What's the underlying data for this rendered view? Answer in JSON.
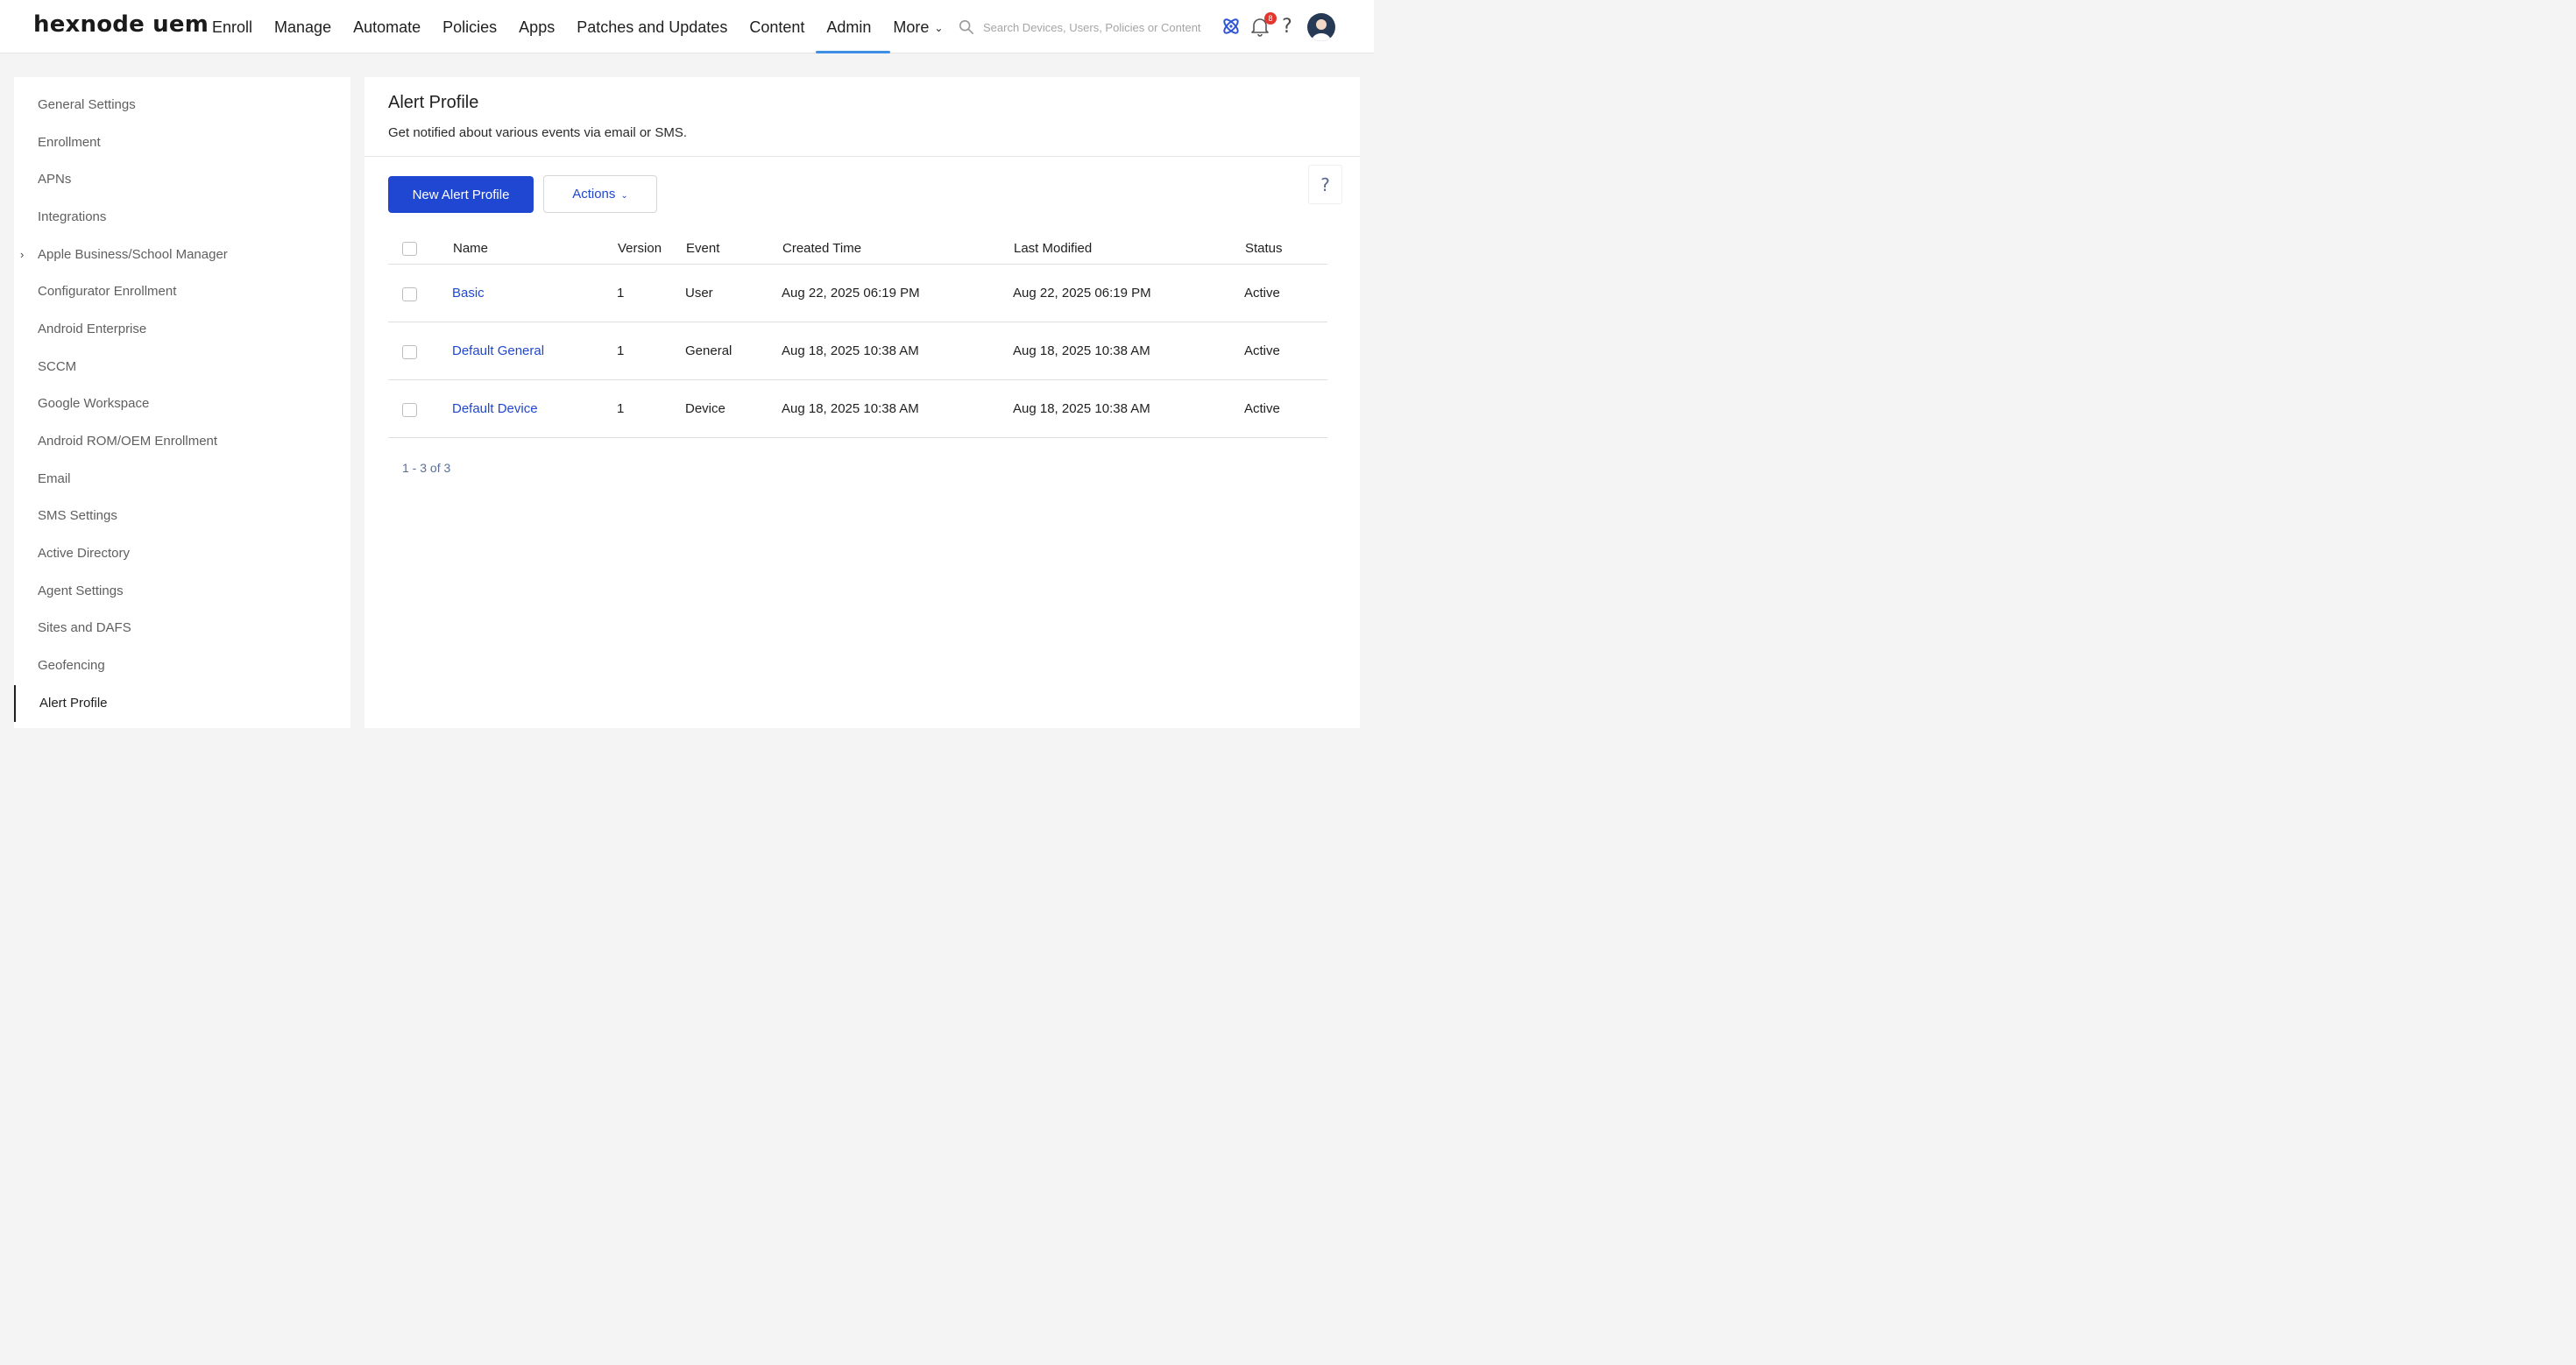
{
  "app": {
    "logo": "hexnode uem"
  },
  "nav": {
    "items": [
      "Enroll",
      "Manage",
      "Automate",
      "Policies",
      "Apps",
      "Patches and Updates",
      "Content",
      "Admin",
      "More"
    ],
    "active": "Admin"
  },
  "search": {
    "placeholder": "Search Devices, Users, Policies or Content"
  },
  "notifications": {
    "count": "8"
  },
  "sidebar": {
    "items": [
      {
        "label": "General Settings"
      },
      {
        "label": "Enrollment"
      },
      {
        "label": "APNs"
      },
      {
        "label": "Integrations"
      },
      {
        "label": "Apple Business/School Manager",
        "expandable": true
      },
      {
        "label": "Configurator Enrollment"
      },
      {
        "label": "Android Enterprise"
      },
      {
        "label": "SCCM"
      },
      {
        "label": "Google Workspace"
      },
      {
        "label": "Android ROM/OEM Enrollment"
      },
      {
        "label": "Email"
      },
      {
        "label": "SMS Settings"
      },
      {
        "label": "Active Directory"
      },
      {
        "label": "Agent Settings"
      },
      {
        "label": "Sites and DAFS"
      },
      {
        "label": "Geofencing"
      },
      {
        "label": "Alert Profile",
        "active": true
      }
    ]
  },
  "page": {
    "title": "Alert Profile",
    "subtitle": "Get notified about various events via email or SMS.",
    "new_button": "New Alert Profile",
    "actions_button": "Actions",
    "help_label": "?"
  },
  "table": {
    "columns": [
      "Name",
      "Version",
      "Event",
      "Created Time",
      "Last Modified",
      "Status"
    ],
    "rows": [
      {
        "name": "Basic",
        "version": "1",
        "event": "User",
        "created": "Aug 22, 2025 06:19 PM",
        "modified": "Aug 22, 2025 06:19 PM",
        "status": "Active"
      },
      {
        "name": "Default General",
        "version": "1",
        "event": "General",
        "created": "Aug 18, 2025 10:38 AM",
        "modified": "Aug 18, 2025 10:38 AM",
        "status": "Active"
      },
      {
        "name": "Default Device",
        "version": "1",
        "event": "Device",
        "created": "Aug 18, 2025 10:38 AM",
        "modified": "Aug 18, 2025 10:38 AM",
        "status": "Active"
      }
    ],
    "pagination": "1 - 3 of 3"
  },
  "colors": {
    "accent": "#1f47d1",
    "nav_underline": "#3f8ee6",
    "badge": "#e2362f"
  }
}
